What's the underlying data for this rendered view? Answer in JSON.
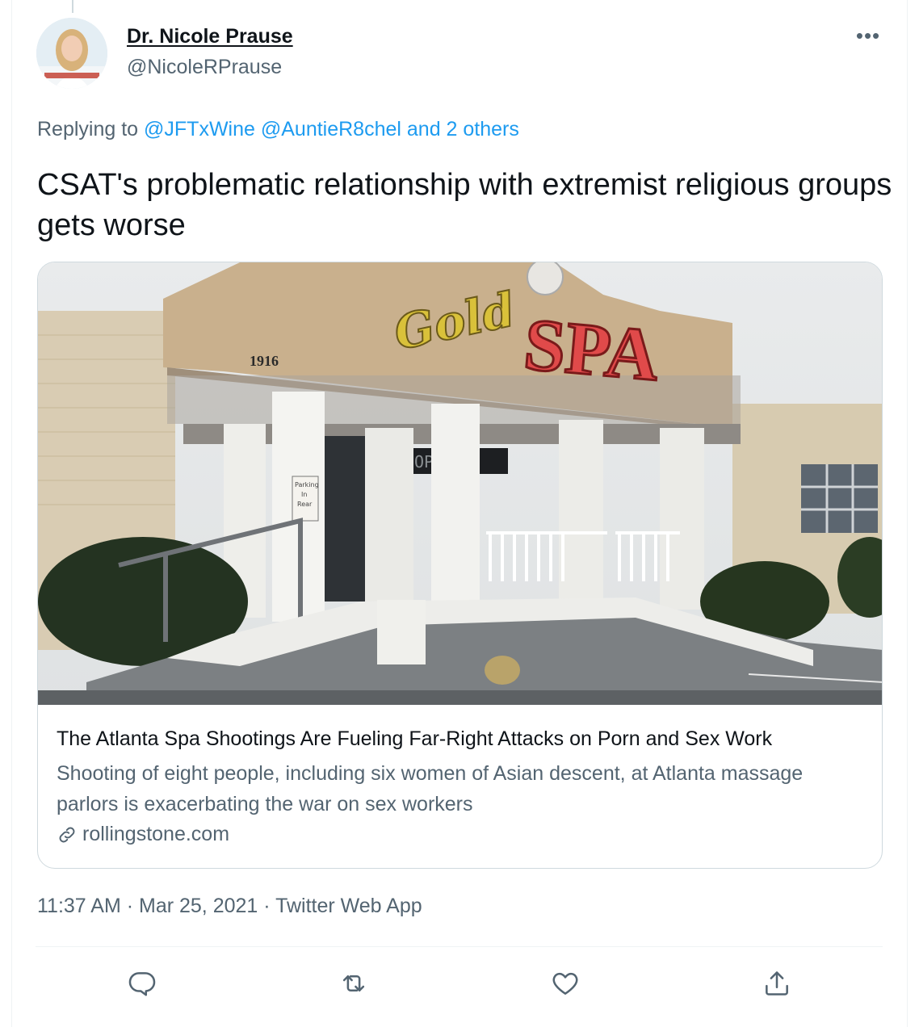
{
  "author": {
    "name": "Dr. Nicole Prause",
    "handle": "@NicoleRPrause"
  },
  "reply": {
    "prefix": "Replying to ",
    "mentions": "@JFTxWine @AuntieR8chel and 2 others"
  },
  "tweet": {
    "text": "CSAT's problematic relationship with extremist religious groups gets worse"
  },
  "card": {
    "image_signs": {
      "number": "1916",
      "sign_script": "Gold",
      "sign_main": "SPA",
      "parking": [
        "Parking",
        "In",
        "Rear"
      ],
      "led": "OP     RS"
    },
    "title": "The Atlanta Spa Shootings Are Fueling Far-Right Attacks on Porn and Sex Work",
    "description": "Shooting of eight people, including six women of Asian descent, at Atlanta massage parlors is exacerbating the war on sex workers",
    "domain": "rollingstone.com",
    "domain_icon": "link-icon"
  },
  "meta": {
    "timestamp": "11:37 AM · Mar 25, 2021 · Twitter Web App"
  },
  "actions": [
    {
      "icon": "reply-icon"
    },
    {
      "icon": "retweet-icon"
    },
    {
      "icon": "like-icon"
    },
    {
      "icon": "share-icon"
    }
  ],
  "colors": {
    "link": "#1d9bf0",
    "secondary_text": "#536471",
    "primary_text": "#0f1419",
    "border": "#cfd9de"
  }
}
